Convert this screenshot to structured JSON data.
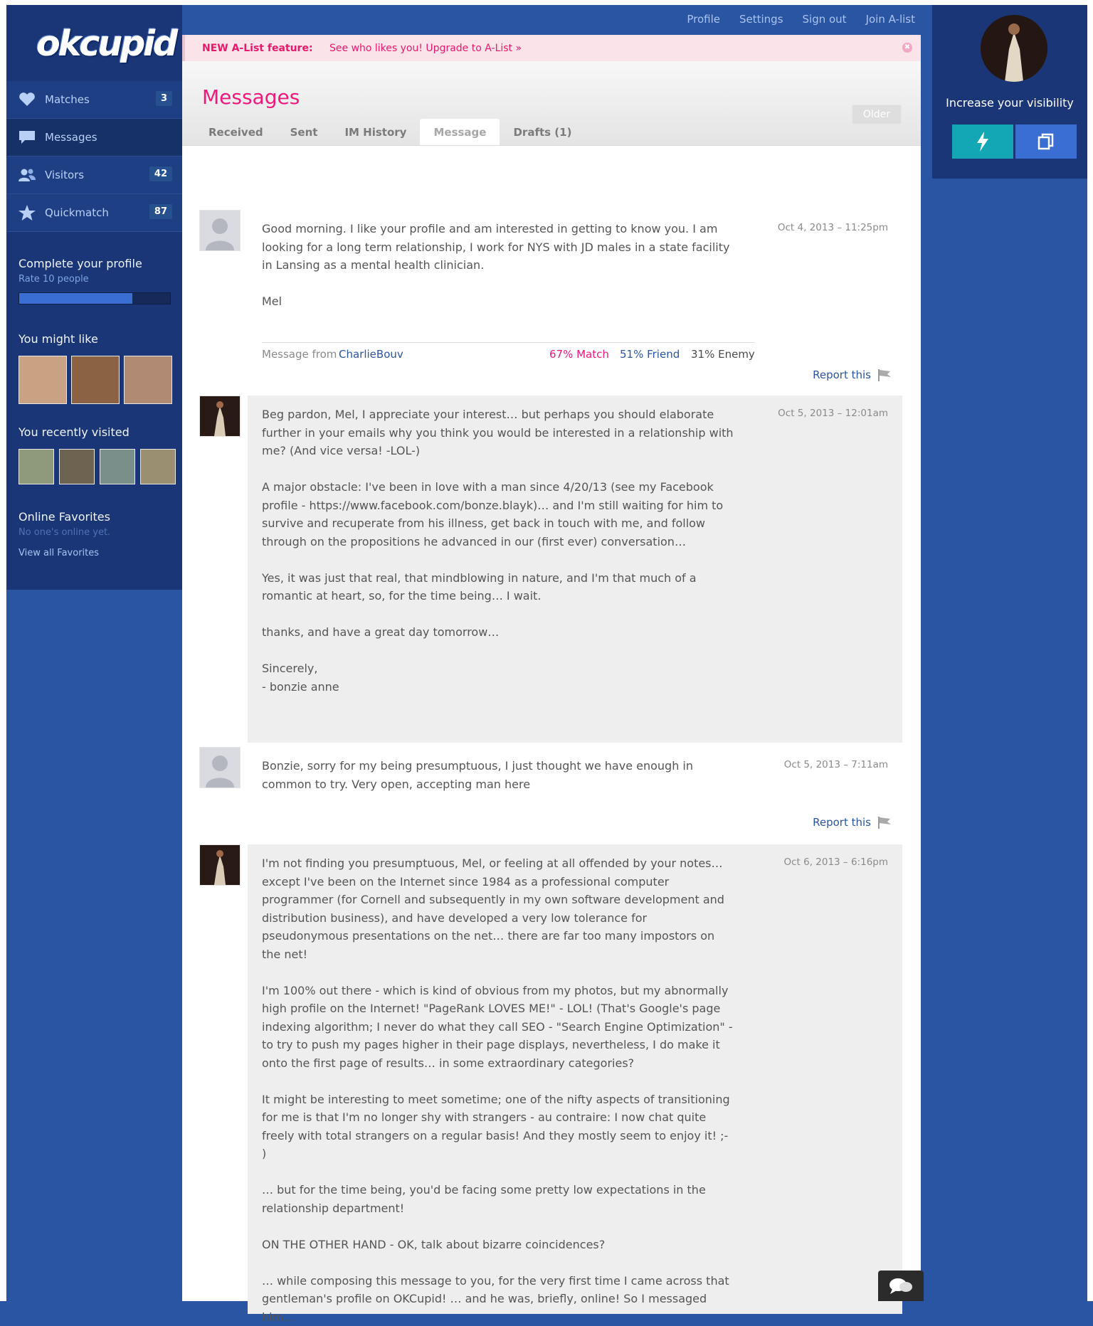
{
  "topnav": {
    "profile": "Profile",
    "settings": "Settings",
    "signout": "Sign out",
    "join": "Join A-list"
  },
  "logo": "okcupid",
  "sidebar": {
    "items": [
      {
        "label": "Matches",
        "badge": "3",
        "icon": "heart-icon"
      },
      {
        "label": "Messages",
        "badge": "",
        "icon": "speech-bubble-icon"
      },
      {
        "label": "Visitors",
        "badge": "42",
        "icon": "people-icon"
      },
      {
        "label": "Quickmatch",
        "badge": "87",
        "icon": "star-icon"
      }
    ],
    "complete_title": "Complete your profile",
    "complete_sub": "Rate 10 people",
    "complete_progress": 0.75,
    "might_like": "You might like",
    "recently_visited": "You recently visited",
    "online_favorites": "Online Favorites",
    "no_one_online": "No one's online yet.",
    "view_all": "View all Favorites"
  },
  "banner": {
    "head": "NEW A-List feature:",
    "link": "See who likes you! Upgrade to A-List »",
    "close": "✖"
  },
  "page": {
    "title": "Messages",
    "older": "Older"
  },
  "tabs": [
    "Received",
    "Sent",
    "IM History",
    "Message",
    "Drafts (1)"
  ],
  "messages": [
    {
      "from": "them",
      "date": "Oct 4, 2013 – 11:25pm",
      "body": "Good morning. I like your profile and am interested in getting to know you. I am looking for a long term relationship, I work for NYS with JD males in a state facility in Lansing as a mental health clinician.\n\nMel",
      "footer": {
        "prefix": "Message from",
        "name": "CharlieBouv",
        "match": "67% Match",
        "friend": "51% Friend",
        "enemy": "31% Enemy"
      },
      "report": "Report this"
    },
    {
      "from": "me",
      "date": "Oct 5, 2013 – 12:01am",
      "body": "Beg pardon, Mel, I appreciate your interest… but perhaps you should elaborate further in your emails why you think you would be interested in a relationship with me? (And vice versa! -LOL-)\n\nA major obstacle: I've been in love with a man since 4/20/13 (see my Facebook profile - https://www.facebook.com/bonze.blayk)… and I'm still waiting for him to survive and recuperate from his illness, get back in touch with me, and follow through on the propositions he advanced in our (first ever) conversation…\n\nYes, it was just that real, that mindblowing in nature, and I'm that much of a romantic at heart, so, for the time being… I wait.\n\nthanks, and have a great day tomorrow…\n\nSincerely,\n- bonzie anne"
    },
    {
      "from": "them",
      "date": "Oct 5, 2013 – 7:11am",
      "body": "Bonzie, sorry for my being presumptuous, I just thought we have enough in common to try. Very open, accepting man here",
      "report": "Report this"
    },
    {
      "from": "me",
      "date": "Oct 6, 2013 – 6:16pm",
      "body": "I'm not finding you presumptuous, Mel, or feeling at all offended by your notes… except I've been on the Internet since 1984 as a professional computer programmer (for Cornell and subsequently in my own software development and distribution business), and have developed a very low tolerance for pseudonymous presentations on the net… there are far too many impostors on the net!\n\nI'm 100% out there - which is kind of obvious from my photos, but my abnormally high profile on the Internet! \"PageRank LOVES ME!\" - LOL! (That's Google's page indexing algorithm; I never do what they call SEO - \"Search Engine Optimization\" - to try to push my pages higher in their page displays, nevertheless, I do make it onto the first page of results… in some extraordinary categories?\n\nIt might be interesting to meet sometime; one of the nifty aspects of transitioning for me is that I'm no longer shy with strangers - au contraire: I now chat quite freely with total strangers on a regular basis! And they mostly seem to enjoy it! ;-\n)\n\n… but for the time being, you'd be facing some pretty low expectations in the relationship department!\n\nON THE OTHER HAND - OK, talk about bizarre coincidences?\n\n… while composing this message to you, for the very first time I came across that gentleman's profile on OKCupid! … and he was, briefly, online! So I messaged him…"
    }
  ],
  "right": {
    "visibility": "Increase your visibility",
    "boost_icon": "lightning-bolt-icon",
    "cards_icon": "photo-stack-icon"
  },
  "colors": {
    "pink": "#ed1a7b",
    "navy": "#1b3676",
    "blue_bg": "#2a55a3",
    "teal": "#13a6b5",
    "boost_blue": "#3a6ed3"
  }
}
